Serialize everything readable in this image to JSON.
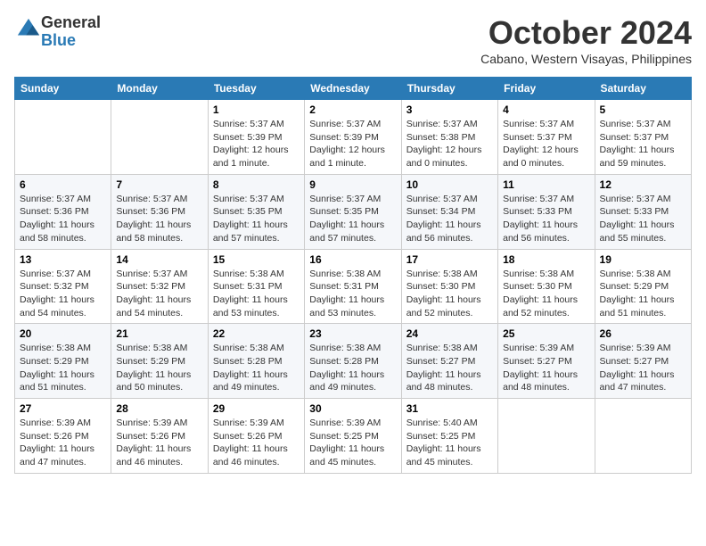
{
  "logo": {
    "general": "General",
    "blue": "Blue"
  },
  "header": {
    "month": "October 2024",
    "location": "Cabano, Western Visayas, Philippines"
  },
  "weekdays": [
    "Sunday",
    "Monday",
    "Tuesday",
    "Wednesday",
    "Thursday",
    "Friday",
    "Saturday"
  ],
  "weeks": [
    [
      {
        "day": "",
        "info": ""
      },
      {
        "day": "",
        "info": ""
      },
      {
        "day": "1",
        "info": "Sunrise: 5:37 AM\nSunset: 5:39 PM\nDaylight: 12 hours and 1 minute."
      },
      {
        "day": "2",
        "info": "Sunrise: 5:37 AM\nSunset: 5:39 PM\nDaylight: 12 hours and 1 minute."
      },
      {
        "day": "3",
        "info": "Sunrise: 5:37 AM\nSunset: 5:38 PM\nDaylight: 12 hours and 0 minutes."
      },
      {
        "day": "4",
        "info": "Sunrise: 5:37 AM\nSunset: 5:37 PM\nDaylight: 12 hours and 0 minutes."
      },
      {
        "day": "5",
        "info": "Sunrise: 5:37 AM\nSunset: 5:37 PM\nDaylight: 11 hours and 59 minutes."
      }
    ],
    [
      {
        "day": "6",
        "info": "Sunrise: 5:37 AM\nSunset: 5:36 PM\nDaylight: 11 hours and 58 minutes."
      },
      {
        "day": "7",
        "info": "Sunrise: 5:37 AM\nSunset: 5:36 PM\nDaylight: 11 hours and 58 minutes."
      },
      {
        "day": "8",
        "info": "Sunrise: 5:37 AM\nSunset: 5:35 PM\nDaylight: 11 hours and 57 minutes."
      },
      {
        "day": "9",
        "info": "Sunrise: 5:37 AM\nSunset: 5:35 PM\nDaylight: 11 hours and 57 minutes."
      },
      {
        "day": "10",
        "info": "Sunrise: 5:37 AM\nSunset: 5:34 PM\nDaylight: 11 hours and 56 minutes."
      },
      {
        "day": "11",
        "info": "Sunrise: 5:37 AM\nSunset: 5:33 PM\nDaylight: 11 hours and 56 minutes."
      },
      {
        "day": "12",
        "info": "Sunrise: 5:37 AM\nSunset: 5:33 PM\nDaylight: 11 hours and 55 minutes."
      }
    ],
    [
      {
        "day": "13",
        "info": "Sunrise: 5:37 AM\nSunset: 5:32 PM\nDaylight: 11 hours and 54 minutes."
      },
      {
        "day": "14",
        "info": "Sunrise: 5:37 AM\nSunset: 5:32 PM\nDaylight: 11 hours and 54 minutes."
      },
      {
        "day": "15",
        "info": "Sunrise: 5:38 AM\nSunset: 5:31 PM\nDaylight: 11 hours and 53 minutes."
      },
      {
        "day": "16",
        "info": "Sunrise: 5:38 AM\nSunset: 5:31 PM\nDaylight: 11 hours and 53 minutes."
      },
      {
        "day": "17",
        "info": "Sunrise: 5:38 AM\nSunset: 5:30 PM\nDaylight: 11 hours and 52 minutes."
      },
      {
        "day": "18",
        "info": "Sunrise: 5:38 AM\nSunset: 5:30 PM\nDaylight: 11 hours and 52 minutes."
      },
      {
        "day": "19",
        "info": "Sunrise: 5:38 AM\nSunset: 5:29 PM\nDaylight: 11 hours and 51 minutes."
      }
    ],
    [
      {
        "day": "20",
        "info": "Sunrise: 5:38 AM\nSunset: 5:29 PM\nDaylight: 11 hours and 51 minutes."
      },
      {
        "day": "21",
        "info": "Sunrise: 5:38 AM\nSunset: 5:29 PM\nDaylight: 11 hours and 50 minutes."
      },
      {
        "day": "22",
        "info": "Sunrise: 5:38 AM\nSunset: 5:28 PM\nDaylight: 11 hours and 49 minutes."
      },
      {
        "day": "23",
        "info": "Sunrise: 5:38 AM\nSunset: 5:28 PM\nDaylight: 11 hours and 49 minutes."
      },
      {
        "day": "24",
        "info": "Sunrise: 5:38 AM\nSunset: 5:27 PM\nDaylight: 11 hours and 48 minutes."
      },
      {
        "day": "25",
        "info": "Sunrise: 5:39 AM\nSunset: 5:27 PM\nDaylight: 11 hours and 48 minutes."
      },
      {
        "day": "26",
        "info": "Sunrise: 5:39 AM\nSunset: 5:27 PM\nDaylight: 11 hours and 47 minutes."
      }
    ],
    [
      {
        "day": "27",
        "info": "Sunrise: 5:39 AM\nSunset: 5:26 PM\nDaylight: 11 hours and 47 minutes."
      },
      {
        "day": "28",
        "info": "Sunrise: 5:39 AM\nSunset: 5:26 PM\nDaylight: 11 hours and 46 minutes."
      },
      {
        "day": "29",
        "info": "Sunrise: 5:39 AM\nSunset: 5:26 PM\nDaylight: 11 hours and 46 minutes."
      },
      {
        "day": "30",
        "info": "Sunrise: 5:39 AM\nSunset: 5:25 PM\nDaylight: 11 hours and 45 minutes."
      },
      {
        "day": "31",
        "info": "Sunrise: 5:40 AM\nSunset: 5:25 PM\nDaylight: 11 hours and 45 minutes."
      },
      {
        "day": "",
        "info": ""
      },
      {
        "day": "",
        "info": ""
      }
    ]
  ]
}
